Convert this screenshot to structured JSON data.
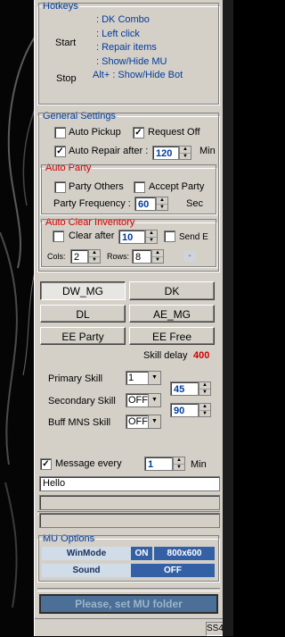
{
  "hotkeys": {
    "legend": "Hotkeys",
    "start_label": "Start",
    "start_items": [
      ": DK Combo",
      ": Left click",
      ": Repair items",
      ": Show/Hide MU"
    ],
    "stop_label": "Stop",
    "stop_item": "Alt+ : Show/Hide Bot"
  },
  "general": {
    "legend": "General Settings",
    "auto_pickup": {
      "label": "Auto Pickup",
      "checked": false
    },
    "request_off": {
      "label": "Request Off",
      "checked": true
    },
    "auto_repair": {
      "label": "Auto Repair after :",
      "checked": true,
      "value": "120",
      "unit": "Min"
    }
  },
  "auto_party": {
    "legend": "Auto Party",
    "party_others": {
      "label": "Party Others",
      "checked": false
    },
    "accept_party": {
      "label": "Accept Party",
      "checked": false
    },
    "frequency_label": "Party Frequency :",
    "frequency_value": "60",
    "frequency_unit": "Sec"
  },
  "auto_clear": {
    "legend": "Auto Clear Inventory",
    "clear_after": {
      "label": "Clear after",
      "checked": false,
      "value": "10"
    },
    "send_e": {
      "label": "Send E",
      "checked": false
    },
    "cols_label": "Cols:",
    "cols_value": "2",
    "rows_label": "Rows:",
    "rows_value": "8",
    "small_btn": "-"
  },
  "classes": {
    "buttons": [
      "DW_MG",
      "DK",
      "DL",
      "AE_MG",
      "EE Party",
      "EE Free"
    ],
    "selected": "DW_MG"
  },
  "skills": {
    "delay_label": "Skill delay",
    "delay_value": "400",
    "primary_label": "Primary Skill",
    "primary_value": "1",
    "secondary_label": "Secondary Skill",
    "secondary_value": "OFF",
    "buff_label": "Buff MNS Skill",
    "buff_value": "OFF",
    "spin_a": "45",
    "spin_b": "90"
  },
  "message": {
    "label": "Message every",
    "checked": true,
    "value": "1",
    "unit": "Min",
    "text": "Hello"
  },
  "mu_options": {
    "legend": "MU Options",
    "winmode_label": "WinMode",
    "winmode_state": "ON",
    "winmode_res": "800x600",
    "sound_label": "Sound",
    "sound_state": "OFF"
  },
  "status": {
    "folder_button": "Please, set MU folder",
    "cell": "SS4"
  },
  "colors": {
    "panel": "#d4d0c8",
    "accent_blue": "#003c9e",
    "accent_red": "#d10000",
    "option_blue": "#3461a6"
  }
}
